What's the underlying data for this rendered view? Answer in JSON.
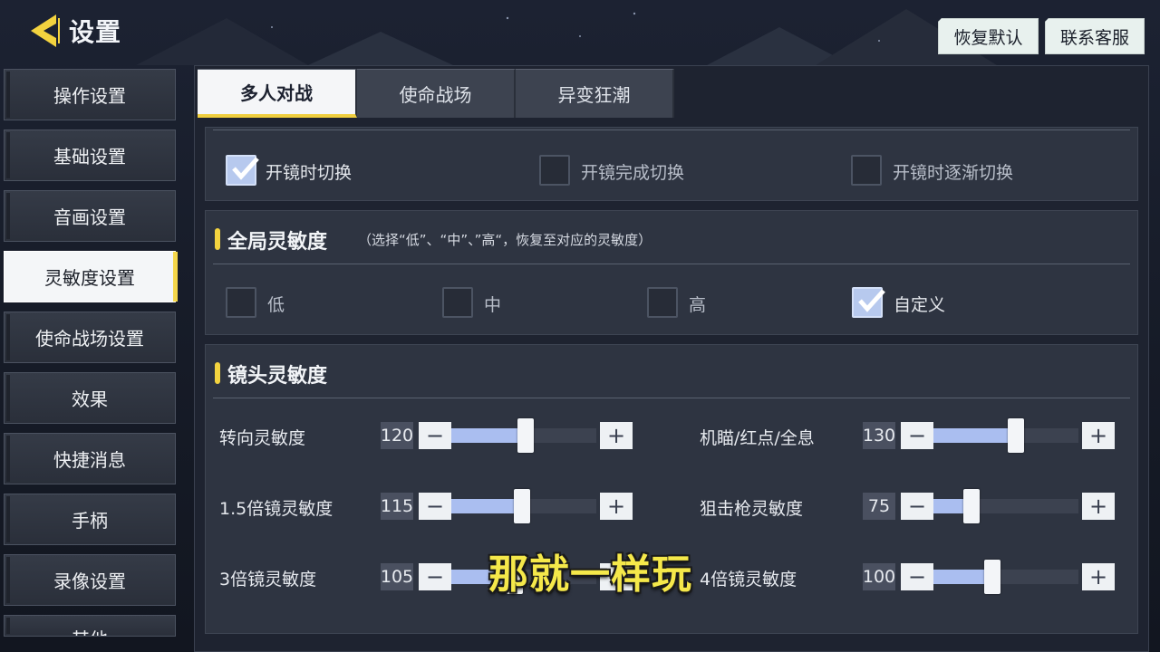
{
  "header": {
    "title": "设置",
    "reset_label": "恢复默认",
    "contact_label": "联系客服"
  },
  "sidebar": {
    "items": [
      {
        "label": "操作设置"
      },
      {
        "label": "基础设置"
      },
      {
        "label": "音画设置"
      },
      {
        "label": "灵敏度设置",
        "active": true
      },
      {
        "label": "使命战场设置"
      },
      {
        "label": "效果"
      },
      {
        "label": "快捷消息"
      },
      {
        "label": "手柄"
      },
      {
        "label": "录像设置"
      },
      {
        "label": "其他"
      }
    ]
  },
  "tabs": [
    {
      "label": "多人对战",
      "active": true
    },
    {
      "label": "使命战场"
    },
    {
      "label": "异变狂潮"
    }
  ],
  "scope_switch": {
    "options": [
      {
        "label": "开镜时切换",
        "checked": true
      },
      {
        "label": "开镜完成切换",
        "checked": false
      },
      {
        "label": "开镜时逐渐切换",
        "checked": false
      }
    ]
  },
  "global_sensitivity": {
    "title": "全局灵敏度",
    "note": "（选择“低”、“中”、”高“，恢复至对应的灵敏度）",
    "options": [
      {
        "label": "低",
        "checked": false
      },
      {
        "label": "中",
        "checked": false
      },
      {
        "label": "高",
        "checked": false
      },
      {
        "label": "自定义",
        "checked": true
      }
    ]
  },
  "camera_sensitivity": {
    "title": "镜头灵敏度",
    "sliders": [
      {
        "label": "转向灵敏度",
        "value": "120",
        "level": 0.39
      },
      {
        "label": "机瞄/红点/全息",
        "value": "130",
        "level": 0.44
      },
      {
        "label": "1.5倍镜灵敏度",
        "value": "115",
        "level": 0.37
      },
      {
        "label": "狙击枪灵敏度",
        "value": "75",
        "level": 0.18
      },
      {
        "label": "3倍镜灵敏度",
        "value": "105",
        "level": 0.33
      },
      {
        "label": "4倍镜灵敏度",
        "value": "100",
        "level": 0.3
      }
    ]
  },
  "controls": {
    "minus": "−",
    "plus": "+"
  },
  "overlay": {
    "subtitle": "那就一样玩"
  },
  "colors": {
    "accent_yellow": "#f3d33f",
    "slider_fill": "#aabef0",
    "checkbox_checked": "#b7c9ee"
  }
}
